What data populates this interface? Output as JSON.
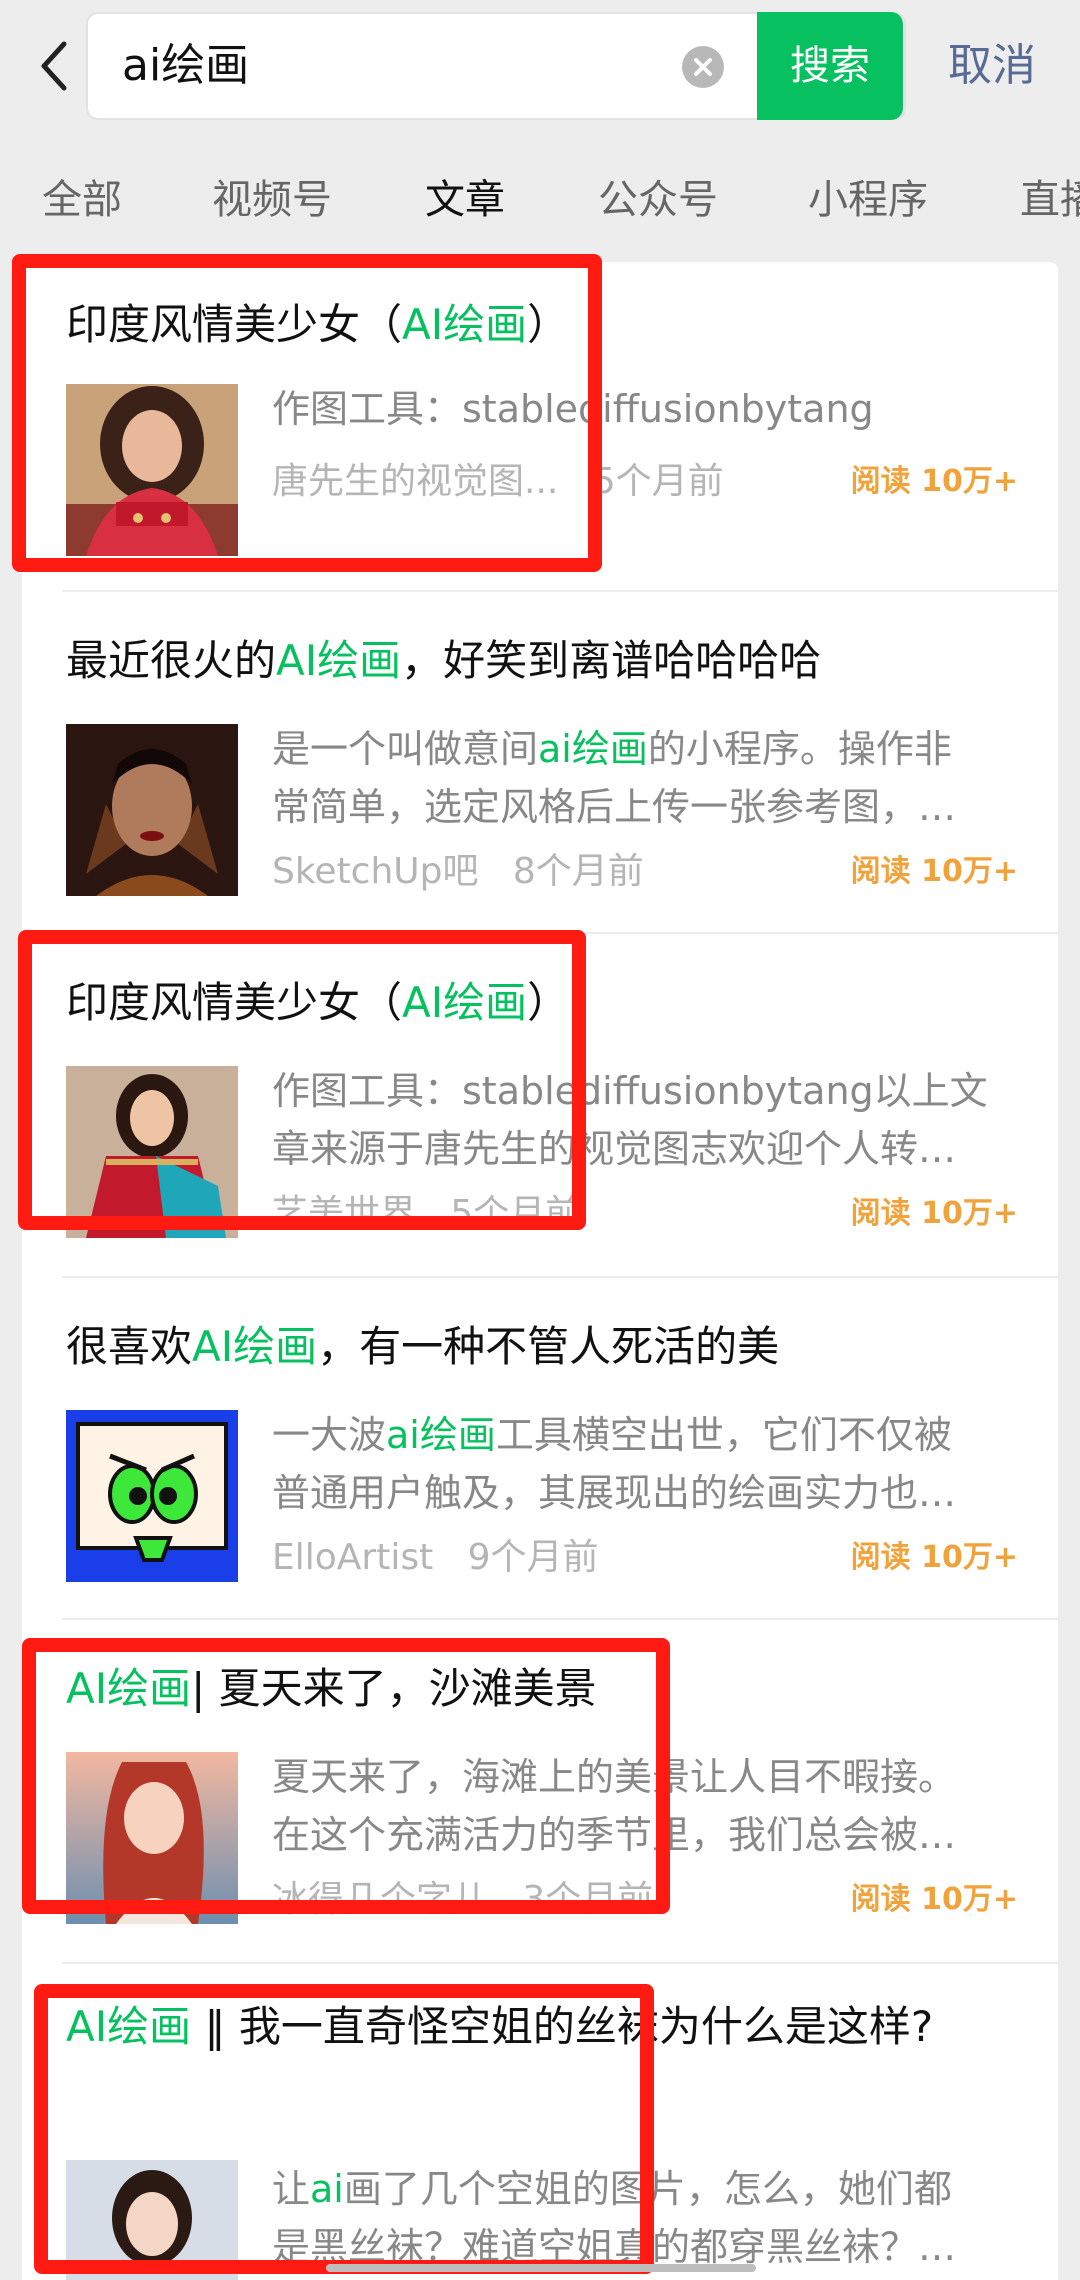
{
  "search": {
    "query": "ai绘画",
    "submit_label": "搜索",
    "cancel_label": "取消"
  },
  "tabs": [
    "全部",
    "视频号",
    "文章",
    "公众号",
    "小程序",
    "直播"
  ],
  "active_tab": "文章",
  "results": [
    {
      "title_parts": [
        {
          "t": "印度风情美少女（",
          "hl": false
        },
        {
          "t": "AI绘画",
          "hl": true
        },
        {
          "t": "）",
          "hl": false
        }
      ],
      "snippet_lines": [
        "作图工具：stablediffusionbytang"
      ],
      "author": "唐先生的视觉图...",
      "time": "5个月前",
      "reads": "阅读 10万+"
    },
    {
      "title_parts": [
        {
          "t": "最近很火的",
          "hl": false
        },
        {
          "t": "AI绘画",
          "hl": true
        },
        {
          "t": "，好笑到离谱哈哈哈哈",
          "hl": false
        }
      ],
      "snippet_lines": [
        "是一个叫做意间ai绘画的小程序。操作非",
        "常简单，选定风格后上传一张参考图，…"
      ],
      "author": "SketchUp吧",
      "time": "8个月前",
      "reads": "阅读 10万+"
    },
    {
      "title_parts": [
        {
          "t": "印度风情美少女（",
          "hl": false
        },
        {
          "t": "AI绘画",
          "hl": true
        },
        {
          "t": "）",
          "hl": false
        }
      ],
      "snippet_lines": [
        "作图工具：stablediffusionbytang以上文",
        "章来源于唐先生的视觉图志欢迎个人转…"
      ],
      "author": "艺美世界",
      "time": "5个月前",
      "reads": "阅读 10万+"
    },
    {
      "title_parts": [
        {
          "t": "很喜欢",
          "hl": false
        },
        {
          "t": "AI绘画",
          "hl": true
        },
        {
          "t": "，有一种不管人死活的美",
          "hl": false
        }
      ],
      "snippet_lines": [
        "一大波ai绘画工具横空出世，它们不仅被",
        "普通用户触及，其展现出的绘画实力也…"
      ],
      "author": "ElloArtist",
      "time": "9个月前",
      "reads": "阅读 10万+"
    },
    {
      "title_parts": [
        {
          "t": "AI绘画",
          "hl": true
        },
        {
          "t": "| 夏天来了，沙滩美景",
          "hl": false
        }
      ],
      "snippet_lines": [
        "夏天来了，海滩上的美景让人目不暇接。",
        "在这个充满活力的季节里，我们总会被…"
      ],
      "author": "冰得几个字儿",
      "time": "3个月前",
      "reads": "阅读 10万+"
    },
    {
      "title_parts": [
        {
          "t": "AI绘画",
          "hl": true
        },
        {
          "t": " ‖ 我一直奇怪空姐的丝袜为什么是这样?",
          "hl": false
        }
      ],
      "snippet_lines": [
        "让ai画了几个空姐的图片，怎么，她们都",
        "是黑丝袜？难道空姐真的都穿黑丝袜？…"
      ],
      "author": "",
      "time": "",
      "reads": ""
    }
  ],
  "colors": {
    "accent": "#07c160",
    "link": "#576b95",
    "reads": "#f0a23b",
    "annotation": "#ff1a12"
  },
  "icons": [
    "back-arrow-icon",
    "clear-icon"
  ]
}
